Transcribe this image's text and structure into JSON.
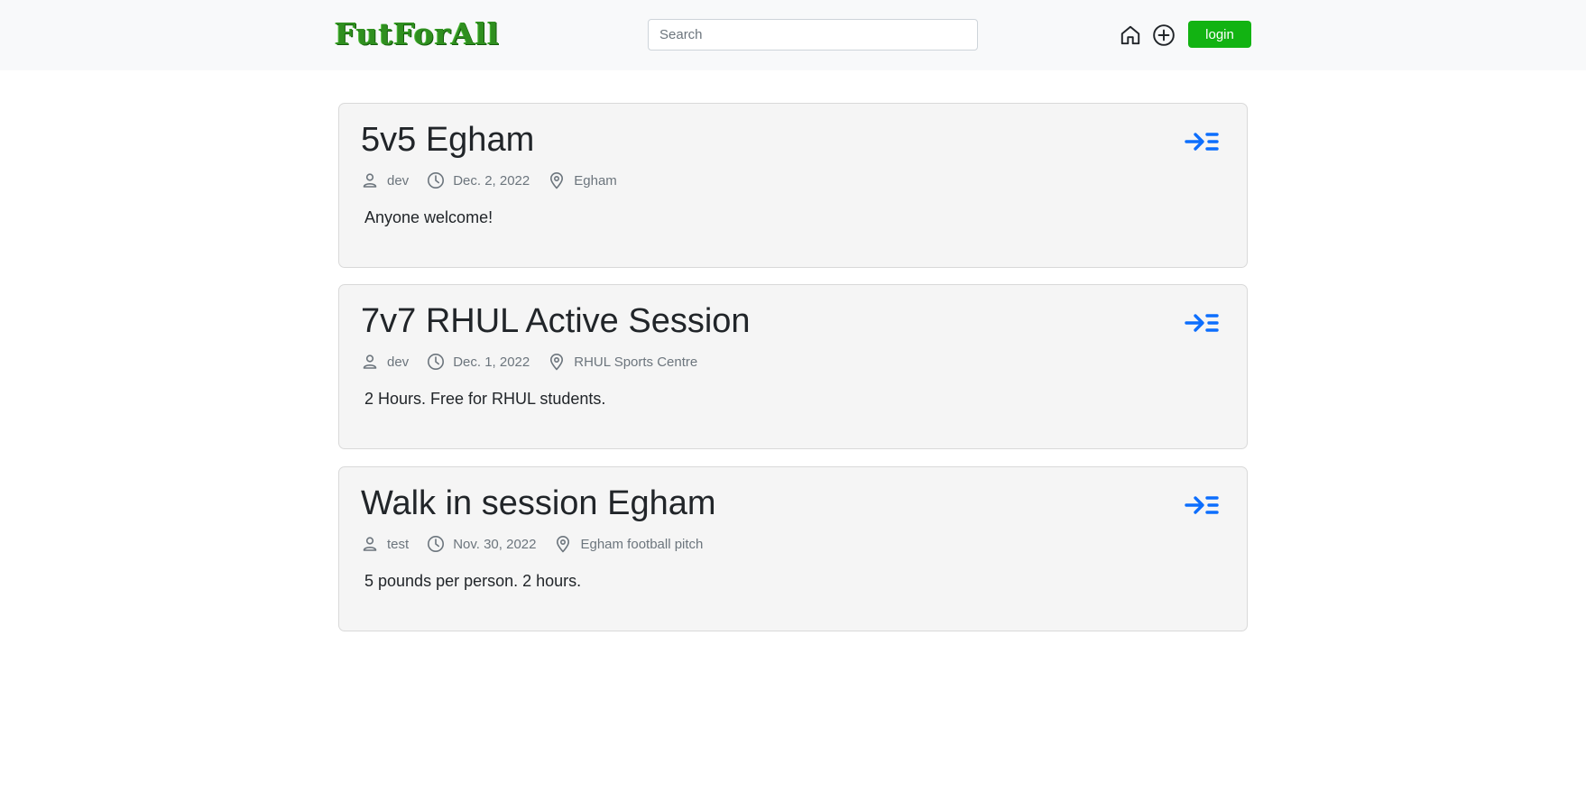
{
  "nav": {
    "logo": "FutForAll",
    "search_placeholder": "Search",
    "search_value": "",
    "home_icon": "home-icon",
    "add_icon": "plus-circle-icon",
    "login_label": "login"
  },
  "colors": {
    "accent_blue": "#0d6efd",
    "login_green": "#12b312",
    "logo_green": "#2f8f1f"
  },
  "posts": [
    {
      "title": "5v5 Egham",
      "author": "dev",
      "date": "Dec. 2, 2022",
      "location": "Egham",
      "description": "Anyone welcome!"
    },
    {
      "title": "7v7 RHUL Active Session",
      "author": "dev",
      "date": "Dec. 1, 2022",
      "location": "RHUL Sports Centre",
      "description": "2 Hours. Free for RHUL students."
    },
    {
      "title": "Walk in session Egham",
      "author": "test",
      "date": "Nov. 30, 2022",
      "location": "Egham football pitch",
      "description": "5 pounds per person. 2 hours."
    }
  ]
}
